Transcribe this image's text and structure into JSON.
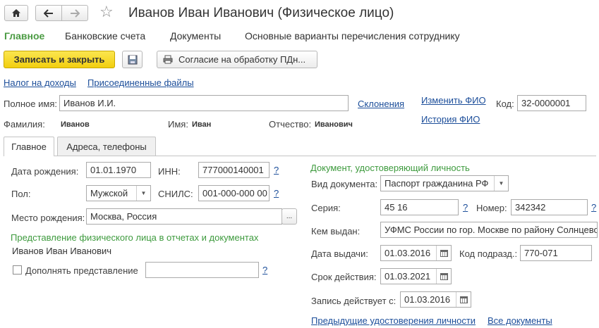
{
  "window": {
    "title": "Иванов Иван Иванович (Физическое лицо)"
  },
  "nav_tabs": [
    {
      "label": "Главное",
      "active": true
    },
    {
      "label": "Банковские счета"
    },
    {
      "label": "Документы"
    },
    {
      "label": "Основные варианты перечисления сотруднику"
    }
  ],
  "toolbar": {
    "save_close_label": "Записать и закрыть",
    "consent_label": "Согласие на обработку ПДн..."
  },
  "links": {
    "income_tax": "Налог на доходы",
    "attached_files": "Присоединенные файлы",
    "declensions": "Склонения",
    "change_fio": "Изменить ФИО",
    "fio_history": "История ФИО"
  },
  "header_fields": {
    "full_name_label": "Полное имя:",
    "full_name_value": "Иванов И.И.",
    "code_label": "Код:",
    "code_value": "32-0000001",
    "surname_label": "Фамилия:",
    "surname_value": "Иванов",
    "name_label": "Имя:",
    "name_value": "Иван",
    "patronymic_label": "Отчество:",
    "patronymic_value": "Иванович"
  },
  "inner_tabs": [
    {
      "label": "Главное",
      "active": true
    },
    {
      "label": "Адреса, телефоны"
    }
  ],
  "left": {
    "birth_date_label": "Дата рождения:",
    "birth_date_value": "01.01.1970",
    "inn_label": "ИНН:",
    "inn_value": "777000140001",
    "gender_label": "Пол:",
    "gender_value": "Мужской",
    "snils_label": "СНИЛС:",
    "snils_value": "001-000-000 00",
    "birth_place_label": "Место рождения:",
    "birth_place_value": "Москва, Россия",
    "ellipsis": "...",
    "representation_header": "Представление физического лица в отчетах и документах",
    "representation_value": "Иванов Иван Иванович",
    "complement_label": "Дополнять представление",
    "complement_value": ""
  },
  "right": {
    "header": "Документ, удостоверяющий личность",
    "doc_type_label": "Вид документа:",
    "doc_type_value": "Паспорт гражданина РФ",
    "series_label": "Серия:",
    "series_value": "45 16",
    "number_label": "Номер:",
    "number_value": "342342",
    "issued_by_label": "Кем выдан:",
    "issued_by_value": "УФМС России по гор. Москве по району Солнцево",
    "issue_date_label": "Дата выдачи:",
    "issue_date_value": "01.03.2016",
    "dept_code_label": "Код подразд.:",
    "dept_code_value": "770-071",
    "validity_label": "Срок действия:",
    "validity_value": "01.03.2021",
    "record_valid_label": "Запись действует с:",
    "record_valid_value": "01.03.2016",
    "prev_docs_link": "Предыдущие удостоверения личности",
    "all_docs_link": "Все документы"
  },
  "help_mark": "?"
}
